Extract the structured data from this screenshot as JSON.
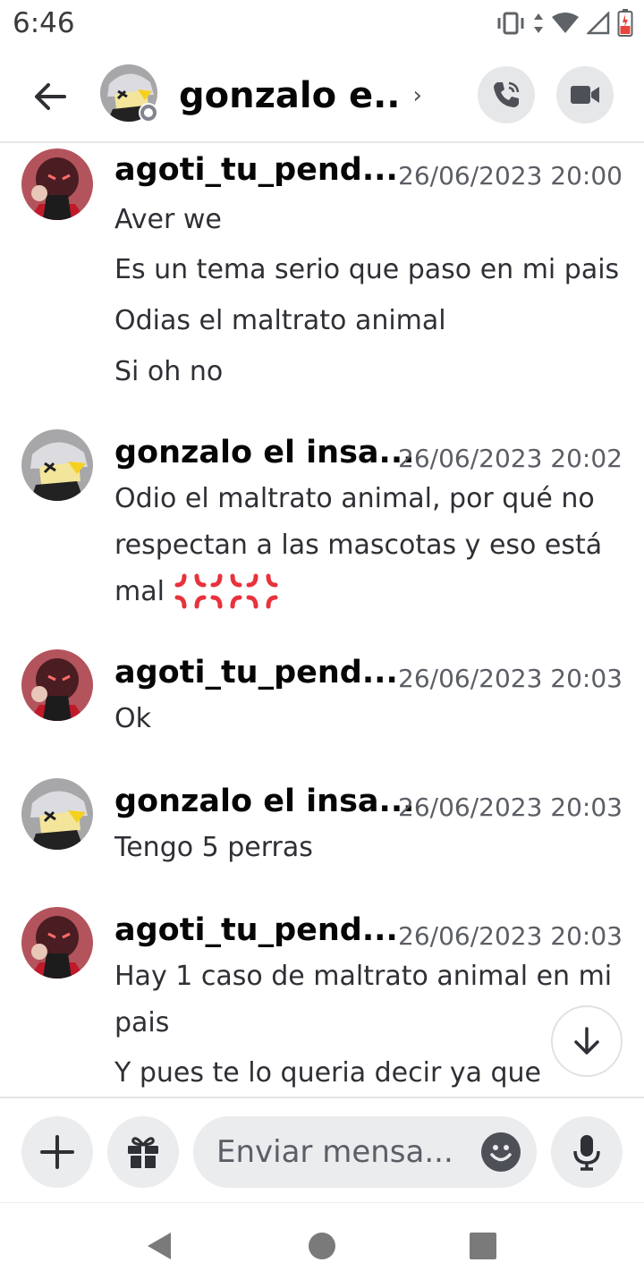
{
  "status_bar": {
    "time": "6:46"
  },
  "header": {
    "title": "gonzalo e..",
    "chevron": "›"
  },
  "messages": [
    {
      "author": "agoti_tu_pend...",
      "timestamp": "26/06/2023 20:00",
      "lines": [
        "Aver we",
        "Es un tema serio que paso en mi pais",
        "Odias el maltrato animal",
        "Si oh no"
      ]
    },
    {
      "author": "gonzalo el insa...",
      "timestamp": "26/06/2023 20:02",
      "lines": [
        "Odio el maltrato animal, por qué no",
        "respectan a las mascotas y eso está",
        "mal"
      ]
    },
    {
      "author": "agoti_tu_pend...",
      "timestamp": "26/06/2023 20:03",
      "lines": [
        "Ok"
      ]
    },
    {
      "author": "gonzalo el insa...",
      "timestamp": "26/06/2023 20:03",
      "lines": [
        "Tengo 5 perras"
      ]
    },
    {
      "author": "agoti_tu_pend...",
      "timestamp": "26/06/2023 20:03",
      "lines": [
        "Hay 1 caso de maltrato animal en mi",
        "pais",
        "Y pues te lo queria decir ya que"
      ]
    }
  ],
  "composer": {
    "placeholder": "Enviar mensa..."
  },
  "icons": {
    "back": "arrow-left-icon",
    "call": "phone-icon",
    "video": "video-camera-icon",
    "add": "plus-icon",
    "gift": "gift-icon",
    "emoji": "smiley-icon",
    "mic": "microphone-icon",
    "scroll_down": "arrow-down-icon",
    "anger": "anger-symbol-icon"
  },
  "colors": {
    "anger_emoji": "#e8323c",
    "status_offline": "#80848e"
  }
}
